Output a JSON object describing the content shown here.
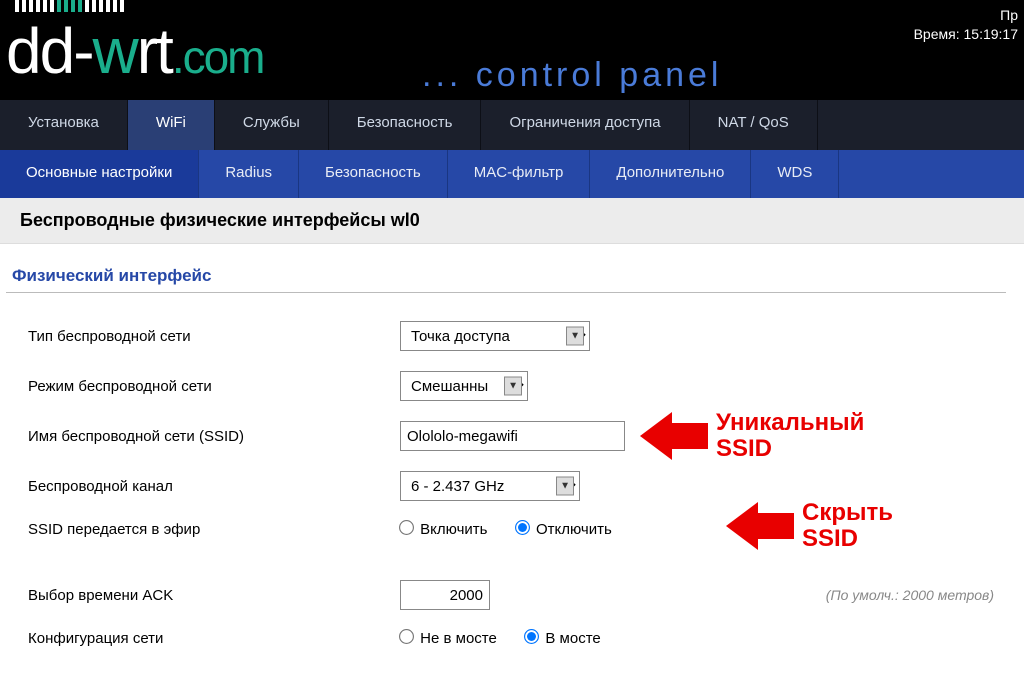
{
  "header": {
    "status_top": "Пр",
    "time_label": "Время:",
    "time_value": "15:19:17",
    "cp_text": "... control panel"
  },
  "main_tabs": {
    "t0": "Установка",
    "t1": "WiFi",
    "t2": "Службы",
    "t3": "Безопасность",
    "t4": "Ограничения доступа",
    "t5": "NAT / QoS"
  },
  "sub_tabs": {
    "s0": "Основные настройки",
    "s1": "Radius",
    "s2": "Безопасность",
    "s3": "MAC-фильтр",
    "s4": "Дополнительно",
    "s5": "WDS"
  },
  "section": {
    "title": "Беспроводные физические интерфейсы wl0",
    "legend": "Физический интерфейс"
  },
  "fields": {
    "wltype": {
      "label": "Тип беспроводной сети",
      "value": "Точка доступа"
    },
    "wlmode": {
      "label": "Режим беспроводной сети",
      "value": "Смешанный"
    },
    "ssid": {
      "label": "Имя беспроводной сети (SSID)",
      "value": "Olololo-megawifi"
    },
    "channel": {
      "label": "Беспроводной канал",
      "value": "6 - 2.437 GHz"
    },
    "broadcast": {
      "label": "SSID передается в эфир",
      "on": "Включить",
      "off": "Отключить"
    },
    "ack": {
      "label": "Выбор времени ACK",
      "value": "2000",
      "note": "(По умолч.: 2000 метров)"
    },
    "netcfg": {
      "label": "Конфигурация сети",
      "unbr": "Не в мосте",
      "br": "В мосте"
    }
  },
  "callouts": {
    "c1a": "Уникальный",
    "c1b": "SSID",
    "c2a": "Скрыть",
    "c2b": "SSID"
  }
}
